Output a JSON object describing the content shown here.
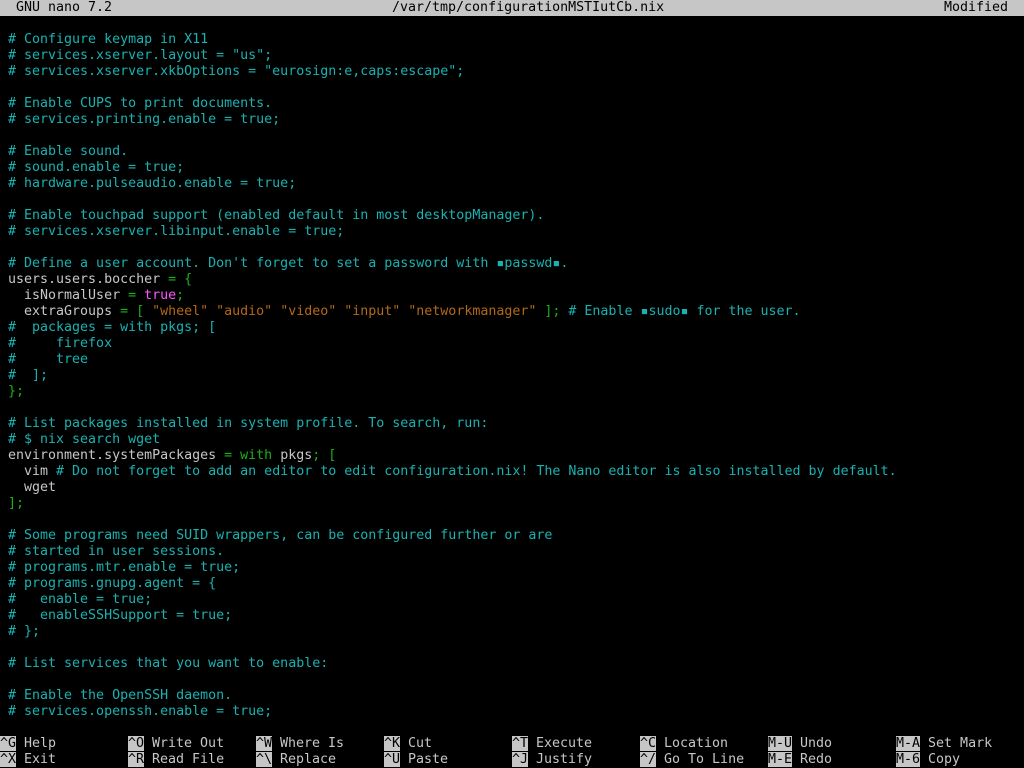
{
  "titlebar": {
    "app": "GNU nano 7.2",
    "file": "/var/tmp/configurationMSTIutCb.nix",
    "status": "Modified"
  },
  "lines": [
    [
      [
        "c",
        "# Configure keymap in X11"
      ]
    ],
    [
      [
        "c",
        "# services.xserver.layout = \"us\";"
      ]
    ],
    [
      [
        "c",
        "# services.xserver.xkbOptions = \"eurosign:e,caps:escape\";"
      ]
    ],
    [],
    [
      [
        "c",
        "# Enable CUPS to print documents."
      ]
    ],
    [
      [
        "c",
        "# services.printing.enable = true;"
      ]
    ],
    [],
    [
      [
        "c",
        "# Enable sound."
      ]
    ],
    [
      [
        "c",
        "# sound.enable = true;"
      ]
    ],
    [
      [
        "c",
        "# hardware.pulseaudio.enable = true;"
      ]
    ],
    [],
    [
      [
        "c",
        "# Enable touchpad support (enabled default in most desktopManager)."
      ]
    ],
    [
      [
        "c",
        "# services.xserver.libinput.enable = true;"
      ]
    ],
    [],
    [
      [
        "c",
        "# Define a user account. Don't forget to set a password with ▪passwd▪."
      ]
    ],
    [
      [
        "",
        "users.users.boccher "
      ],
      [
        "p",
        "= {"
      ]
    ],
    [
      [
        "",
        "  isNormalUser "
      ],
      [
        "p",
        "= "
      ],
      [
        "b",
        "true"
      ],
      [
        "p",
        ";"
      ]
    ],
    [
      [
        "",
        "  extraGroups "
      ],
      [
        "p",
        "= [ "
      ],
      [
        "s",
        "\"wheel\" \"audio\" \"video\" \"input\" \"networkmanager\""
      ],
      [
        "p",
        " ]; "
      ],
      [
        "c",
        "# Enable ▪sudo▪ for the user."
      ]
    ],
    [
      [
        "c",
        "#  packages = with pkgs; ["
      ]
    ],
    [
      [
        "c",
        "#     firefox"
      ]
    ],
    [
      [
        "c",
        "#     tree"
      ]
    ],
    [
      [
        "c",
        "#  ];"
      ]
    ],
    [
      [
        "p",
        "};"
      ]
    ],
    [],
    [
      [
        "c",
        "# List packages installed in system profile. To search, run:"
      ]
    ],
    [
      [
        "c",
        "# $ nix search wget"
      ]
    ],
    [
      [
        "",
        "environment.systemPackages "
      ],
      [
        "p",
        "= with "
      ],
      [
        "",
        "pkgs"
      ],
      [
        "p",
        "; ["
      ]
    ],
    [
      [
        "",
        "  vim "
      ],
      [
        "c",
        "# Do not forget to add an editor to edit configuration.nix! The Nano editor is also installed by default."
      ]
    ],
    [
      [
        "",
        "  wget"
      ]
    ],
    [
      [
        "p",
        "];"
      ]
    ],
    [],
    [
      [
        "c",
        "# Some programs need SUID wrappers, can be configured further or are"
      ]
    ],
    [
      [
        "c",
        "# started in user sessions."
      ]
    ],
    [
      [
        "c",
        "# programs.mtr.enable = true;"
      ]
    ],
    [
      [
        "c",
        "# programs.gnupg.agent = {"
      ]
    ],
    [
      [
        "c",
        "#   enable = true;"
      ]
    ],
    [
      [
        "c",
        "#   enableSSHSupport = true;"
      ]
    ],
    [
      [
        "c",
        "# };"
      ]
    ],
    [],
    [
      [
        "c",
        "# List services that you want to enable:"
      ]
    ],
    [],
    [
      [
        "c",
        "# Enable the OpenSSH daemon."
      ]
    ],
    [
      [
        "c",
        "# services.openssh.enable = true;"
      ]
    ]
  ],
  "shortcuts": [
    {
      "key": "^G",
      "label": "Help"
    },
    {
      "key": "^X",
      "label": "Exit"
    },
    {
      "key": "^O",
      "label": "Write Out"
    },
    {
      "key": "^R",
      "label": "Read File"
    },
    {
      "key": "^W",
      "label": "Where Is"
    },
    {
      "key": "^\\",
      "label": "Replace"
    },
    {
      "key": "^K",
      "label": "Cut"
    },
    {
      "key": "^U",
      "label": "Paste"
    },
    {
      "key": "^T",
      "label": "Execute"
    },
    {
      "key": "^J",
      "label": "Justify"
    },
    {
      "key": "^C",
      "label": "Location"
    },
    {
      "key": "^/",
      "label": "Go To Line"
    },
    {
      "key": "M-U",
      "label": "Undo"
    },
    {
      "key": "M-E",
      "label": "Redo"
    },
    {
      "key": "M-A",
      "label": "Set Mark"
    },
    {
      "key": "M-6",
      "label": "Copy"
    }
  ]
}
